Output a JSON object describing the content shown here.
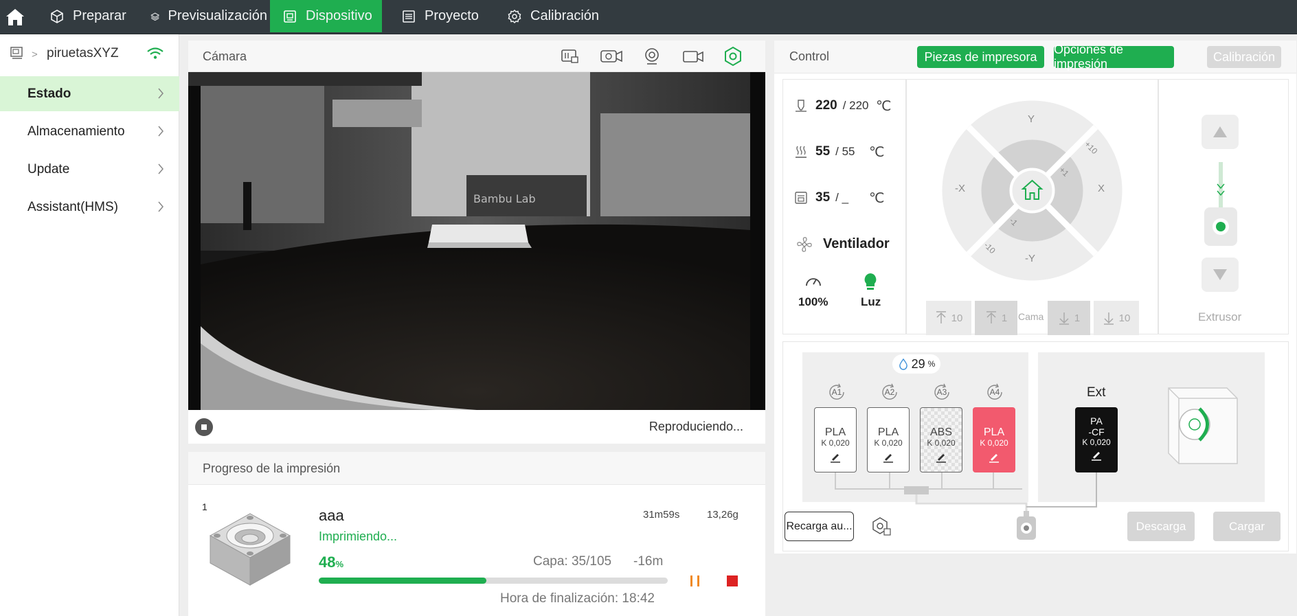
{
  "topbar": {
    "tabs": [
      {
        "label": "Preparar",
        "icon": "cube-icon"
      },
      {
        "label": "Previsualización",
        "icon": "layers-icon"
      },
      {
        "label": "Dispositivo",
        "icon": "device-icon"
      },
      {
        "label": "Proyecto",
        "icon": "list-icon"
      },
      {
        "label": "Calibración",
        "icon": "gear-icon"
      }
    ],
    "active_tab": "Dispositivo",
    "accent": "#1fae50"
  },
  "sidebar": {
    "device_name": "piruetasXYZ",
    "items": [
      {
        "label": "Estado",
        "active": true
      },
      {
        "label": "Almacenamiento",
        "active": false
      },
      {
        "label": "Update",
        "active": false
      },
      {
        "label": "Assistant(HMS)",
        "active": false
      }
    ]
  },
  "camera": {
    "title": "Cámara",
    "status": "Reproduciendo...",
    "icons": [
      "sd-card-icon",
      "video-record-icon",
      "webcam-icon",
      "camera-icon",
      "settings-icon"
    ]
  },
  "progress": {
    "title": "Progreso de la impresión",
    "count": "1",
    "job_name": "aaa",
    "status": "Imprimiendo...",
    "time": "31m59s",
    "weight": "13,26g",
    "percent": "48",
    "percent_unit": "%",
    "percent_value": 0.48,
    "layer": "Capa: 35/105",
    "remaining": "-16m",
    "finish": "Hora de finalización: 18:42"
  },
  "control": {
    "title": "Control",
    "buttons": {
      "parts": "Piezas de impresora",
      "options": "Opciones de impresión",
      "calibration": "Calibración"
    },
    "nozzle": {
      "current": "220",
      "target": "/ 220",
      "unit": "℃"
    },
    "bed": {
      "current": "55",
      "target": "/ 55",
      "unit": "℃"
    },
    "chamber": {
      "current": "35",
      "target": "/ _",
      "unit": "℃"
    },
    "fan_label": "Ventilador",
    "speed": "100%",
    "light": "Luz",
    "jog": {
      "y_plus": "Y",
      "y_minus": "-Y",
      "x_plus": "X",
      "x_minus": "-X",
      "plus10": "+10",
      "plus1": "+1",
      "minus1": "-1",
      "minus10": "-10"
    },
    "bed_buttons": {
      "up10": "10",
      "up1": "1",
      "label": "Cama",
      "down1": "1",
      "down10": "10"
    },
    "extruder_label": "Extrusor"
  },
  "ams": {
    "humidity": "29",
    "humidity_unit": "%",
    "slots": [
      {
        "id": "A1",
        "material": "PLA",
        "k": "K 0,020",
        "color": "#ffffff"
      },
      {
        "id": "A2",
        "material": "PLA",
        "k": "K 0,020",
        "color": "#ffffff"
      },
      {
        "id": "A3",
        "material": "ABS",
        "k": "K 0,020",
        "color": "transparent"
      },
      {
        "id": "A4",
        "material": "PLA",
        "k": "K 0,020",
        "color": "#f25a6e"
      }
    ],
    "ext": {
      "title": "Ext",
      "material_line1": "PA",
      "material_line2": "-CF",
      "k": "K 0,020",
      "color": "#111111"
    },
    "reload_button": "Recarga au...",
    "unload_button": "Descarga",
    "load_button": "Cargar"
  }
}
